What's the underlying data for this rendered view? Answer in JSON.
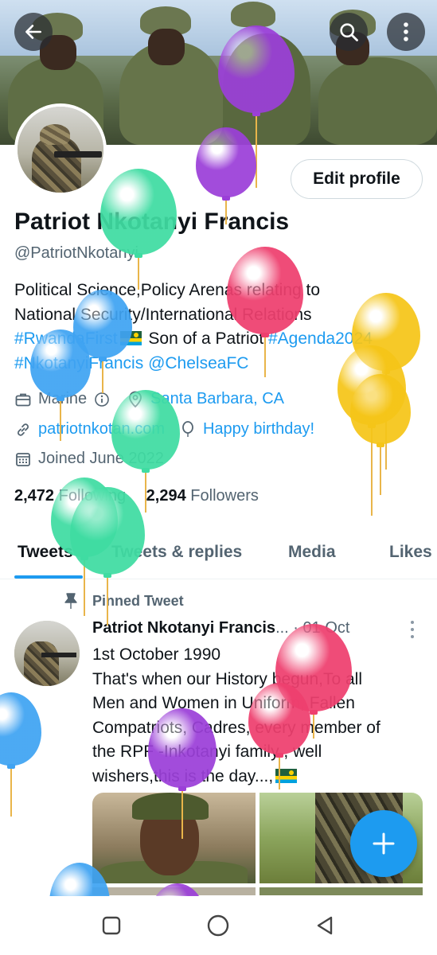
{
  "header": {
    "back_icon": "arrow-left-icon",
    "search_icon": "search-icon",
    "more_icon": "more-vertical-icon"
  },
  "profile": {
    "edit_label": "Edit profile",
    "name": "Patriot Nkotanyi Francis",
    "handle": "@PatriotNkotanyi",
    "bio_line1": "Political Science,Policy Arenas relating to",
    "bio_line2": "National Security/International Relations",
    "bio_tag1": "#RwandaFirst",
    "bio_text3": " Son of a Patriot  ",
    "bio_tag2": "#Agenda2024",
    "bio_tag3": "#NkotanyiFrancis",
    "bio_tag4": "@ChelseaFC",
    "category": "Marine",
    "location": "Santa Barbara, CA",
    "website": "patriotnkotan.com",
    "birthday": "Happy birthday!",
    "joined": "Joined June 2022",
    "following_count": "2,472",
    "following_label": "Following",
    "followers_count": "2,294",
    "followers_label": "Followers"
  },
  "tabs": [
    {
      "label": "Tweets",
      "active": true
    },
    {
      "label": "Tweets & replies",
      "active": false
    },
    {
      "label": "Media",
      "active": false
    },
    {
      "label": "Likes",
      "active": false
    }
  ],
  "pinned": {
    "label": "Pinned Tweet",
    "author": "Patriot Nkotanyi Francis",
    "ellipsis": "...",
    "separator": "·",
    "date": "01 Oct",
    "line1": "1st October 1990",
    "line2": "That's when our History begun,To all",
    "line3": "Men and Women in Uniform, Fallen",
    "line4": "Compatriots, Cadres, every member of",
    "line5": "the RPF -Inkotanyi family , well",
    "line6": "wishers,this is the day...,"
  },
  "colors": {
    "accent": "#1d9bf0",
    "text_primary": "#0f1419",
    "text_secondary": "#536471",
    "balloon_purple": "#9b3fd8",
    "balloon_green": "#3fdca2",
    "balloon_red": "#ee3f6e",
    "balloon_blue": "#3fa3f2",
    "balloon_yellow": "#f5c518"
  },
  "fab": {
    "icon": "plus-icon"
  },
  "nav": {
    "recents_icon": "square-icon",
    "home_icon": "circle-icon",
    "back_icon": "triangle-back-icon"
  }
}
